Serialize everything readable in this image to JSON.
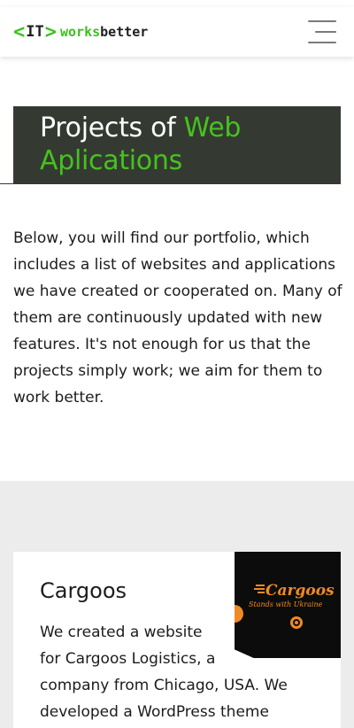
{
  "header": {
    "logo_bracket_left": "<",
    "logo_it": "IT",
    "logo_bracket_right": ">",
    "logo_word_green": "works",
    "logo_word_dark": "better"
  },
  "banner": {
    "title_part1": "Projects of ",
    "title_accent": "Web Aplications"
  },
  "intro": {
    "text": "Below, you will find our portfolio, which includes a list of websites and applications we have created or cooperated on. Many of them are continuously updated with new features. It's not enough for us that the projects simply work; we aim for them to work better."
  },
  "projects": [
    {
      "title": "Cargoos",
      "lines": [
        "We created a website",
        "for Cargoos Logistics, a",
        "company from Chicago, USA. We",
        "developed a WordPress theme"
      ],
      "thumbnail": {
        "brand": "Cargoos",
        "tagline": "Stands with Ukraine"
      }
    }
  ],
  "colors": {
    "accent_green": "#46c21f",
    "banner_bg": "#343a32",
    "section_gray": "#ececec",
    "thumb_orange": "#f08a24"
  }
}
